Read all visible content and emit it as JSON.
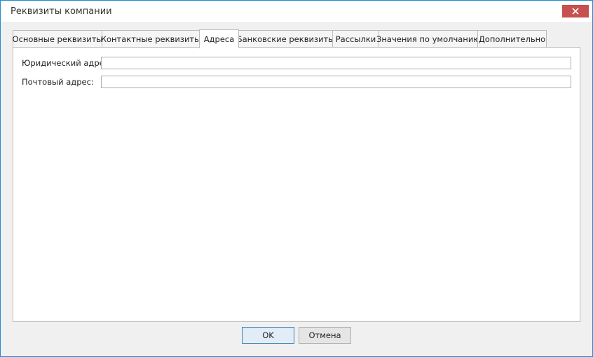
{
  "window": {
    "title": "Реквизиты компании"
  },
  "tabs": [
    {
      "label": "Основные реквизиты",
      "active": false
    },
    {
      "label": "Контактные реквизиты",
      "active": false
    },
    {
      "label": "Адреса",
      "active": true
    },
    {
      "label": "Банковские реквизиты",
      "active": false
    },
    {
      "label": "Рассылки",
      "active": false
    },
    {
      "label": "Значения по умолчанию",
      "active": false
    },
    {
      "label": "Дополнительно",
      "active": false
    }
  ],
  "form": {
    "legal_address": {
      "label": "Юридический адрес:",
      "value": ""
    },
    "postal_address": {
      "label": "Почтовый адрес:",
      "value": ""
    }
  },
  "buttons": {
    "ok": "OK",
    "cancel": "Отмена"
  },
  "colors": {
    "close_button": "#c75050",
    "window_border": "#1e8cd6"
  },
  "icons": {
    "close": "close-icon"
  }
}
